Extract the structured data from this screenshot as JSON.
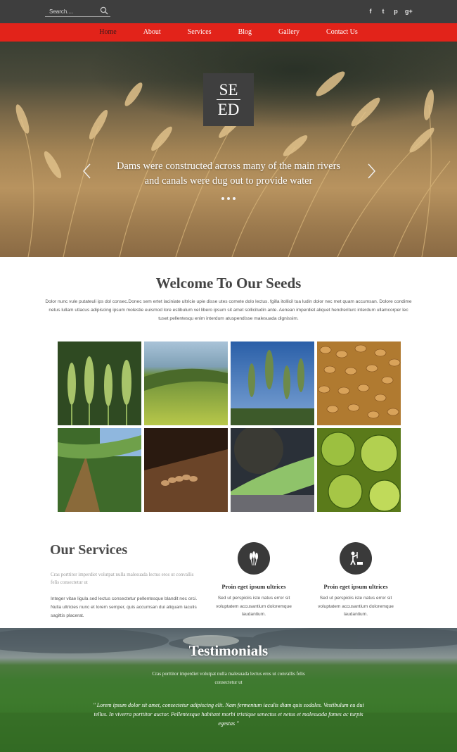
{
  "search": {
    "placeholder": "Search...."
  },
  "social": [
    {
      "name": "facebook-icon",
      "glyph": "f"
    },
    {
      "name": "twitter-icon",
      "glyph": "t"
    },
    {
      "name": "pinterest-icon",
      "glyph": "p"
    },
    {
      "name": "google-plus-icon",
      "glyph": "g+"
    }
  ],
  "nav": {
    "items": [
      {
        "label": "Home",
        "active": true
      },
      {
        "label": "About"
      },
      {
        "label": "Services"
      },
      {
        "label": "Blog"
      },
      {
        "label": "Gallery"
      },
      {
        "label": "Contact Us"
      }
    ]
  },
  "hero": {
    "logo_line1": "SE",
    "logo_line2": "ED",
    "caption_line1": "Dams were constructed across many of the main rivers",
    "caption_line2": "and canals were dug out to provide water",
    "slide_count": 3
  },
  "welcome": {
    "title": "Welcome To Our Seeds",
    "text": "Dolor nunc vule putateuli ips dol consec.Donec sem ertet laciniate ultricie upie disse utes comete dolo lectus. fgilla itollicil tua ludin dolor nec met quam accumsan. Dolore condime netus lullam utlacus adipiscing ipsum molestie euismod lore estibulum vel libero ipsum sit amet sollicitudin ante. Aenean imperdiet aliquet hendreriturc interdum ullamcorper lec tuset pellentesqu enim interdum atuspendisse malesuada dignissim."
  },
  "gallery": [
    {
      "name": "gallery-image-wheat-ears"
    },
    {
      "name": "gallery-image-green-field"
    },
    {
      "name": "gallery-image-wheat-sky"
    },
    {
      "name": "gallery-image-grains"
    },
    {
      "name": "gallery-image-corn-leaves"
    },
    {
      "name": "gallery-image-seeds-wood"
    },
    {
      "name": "gallery-image-sunflower-seeds"
    },
    {
      "name": "gallery-image-limes"
    }
  ],
  "services": {
    "title": "Our Services",
    "subtitle": "Cras porttitor imperdiet volutpat nulla malesuada lectus eros ut convallis felis consectetur ut",
    "body": "Integer vitae ligula sed lectus consectetur pellentesque blandit nec orci. Nulla ultricies nunc et lorem semper, quis accumsan dui aliquam iaculis sagittis placerat.",
    "features": [
      {
        "icon": "wheat-icon",
        "title": "Proin eget ipsum ultrices",
        "text": "Sed ut perspiciis iste natus error sit voluptatem accusantium doloremque laudantium."
      },
      {
        "icon": "farmer-icon",
        "title": "Proin eget ipsum ultrices",
        "text": "Sed ut perspiciis iste natus error sit voluptatem accusantium doloremque laudantium."
      }
    ]
  },
  "testimonials": {
    "title": "Testimonials",
    "subtitle": "Cras porttitor imperdiet volutpat nulla malesuada lectus eros ut convallis felis consectetur ut",
    "quote": "\" Lorem ipsum dolor sit amet, consectetur adipiscing elit. Nam fermentum iaculis diam quis sodales. Vestibulum eu dui tellus. In viverra porttitor auctor. Pellentesque habitant morbi tristique senectus et netus et malesuada fames ac turpis egestas \""
  },
  "colors": {
    "topbar": "#3e3e3e",
    "nav": "#e2231a",
    "logo_box": "#3f3f3f",
    "icon_circle": "#3a3a3a"
  }
}
